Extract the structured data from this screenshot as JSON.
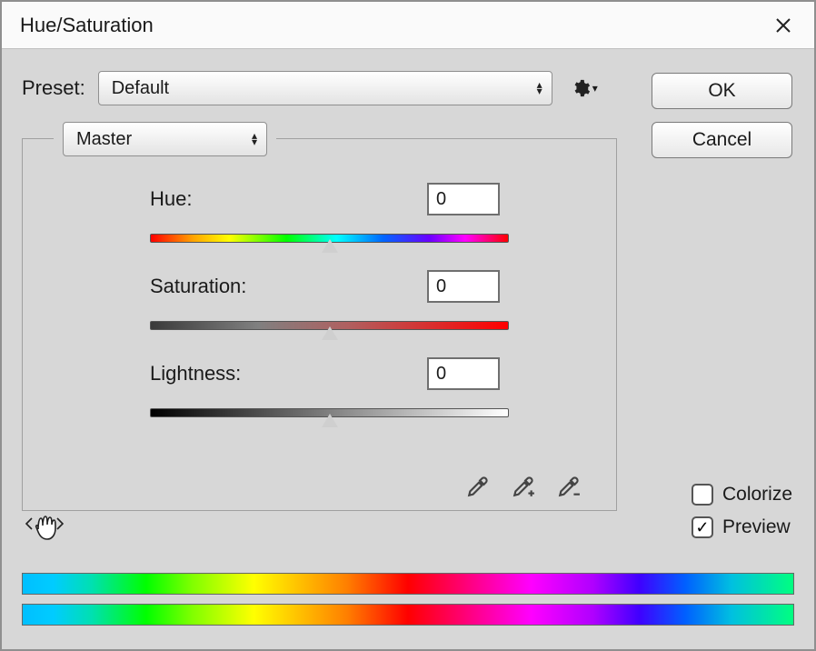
{
  "title": "Hue/Saturation",
  "preset_label": "Preset:",
  "preset_value": "Default",
  "edit_value": "Master",
  "buttons": {
    "ok": "OK",
    "cancel": "Cancel"
  },
  "sliders": {
    "hue": {
      "label": "Hue:",
      "value": "0"
    },
    "saturation": {
      "label": "Saturation:",
      "value": "0"
    },
    "lightness": {
      "label": "Lightness:",
      "value": "0"
    }
  },
  "colorize": {
    "label": "Colorize",
    "checked": false
  },
  "preview": {
    "label": "Preview",
    "checked": true
  }
}
